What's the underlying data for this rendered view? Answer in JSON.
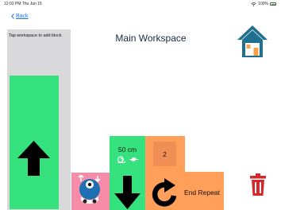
{
  "status_bar": {
    "time": "12:03 PM  Thu Jun 15",
    "battery": "100%"
  },
  "nav": {
    "back_label": "Back"
  },
  "palette": {
    "hint": "Tap workspace to add block"
  },
  "workspace": {
    "title": "Main Workspace"
  },
  "blocks": {
    "distance_label": "50 cm",
    "repeat_count": "2",
    "end_repeat_label": "End Repeat"
  },
  "colors": {
    "green_block": "#35e27d",
    "orange_block": "#ff9f5a",
    "pink_block": "#f58ca8",
    "trash": "#d7262c",
    "home_teal": "#1f6f8f",
    "link": "#1a73e8"
  },
  "icons": [
    "wifi-icon",
    "battery-icon",
    "back-chevron-icon",
    "up-arrow-icon",
    "home-icon",
    "snail-icon",
    "turtle-icon",
    "down-arrow-icon",
    "dash-robot-icon",
    "turn-right-icon",
    "trash-icon"
  ]
}
